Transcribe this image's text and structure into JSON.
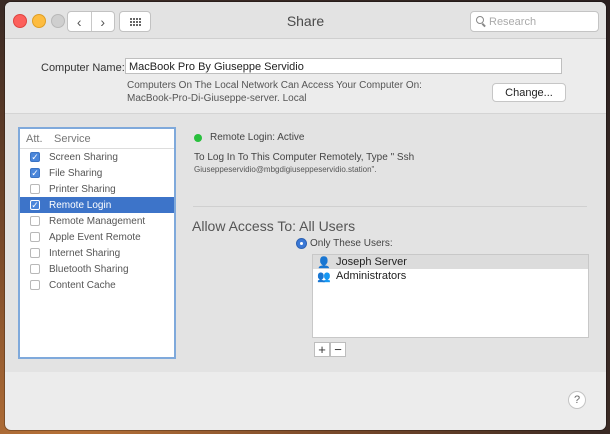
{
  "window": {
    "title": "Share"
  },
  "nav": {
    "back_icon": "‹",
    "forward_icon": "›"
  },
  "search": {
    "placeholder": "Research"
  },
  "computer": {
    "label": "Computer Name:",
    "value": "MacBook Pro By Giuseppe Servidio",
    "info_line1": "Computers On The Local Network Can Access Your Computer On:",
    "info_line2": "MacBook-Pro-Di-Giuseppe-server. Local",
    "change_label": "Change..."
  },
  "services": {
    "header_att": "Att.",
    "header_service": "Service",
    "items": [
      {
        "label": "Screen Sharing",
        "checked": true,
        "selected": false
      },
      {
        "label": "File Sharing",
        "checked": true,
        "selected": false
      },
      {
        "label": "Printer Sharing",
        "checked": false,
        "selected": false
      },
      {
        "label": "Remote Login",
        "checked": true,
        "selected": true
      },
      {
        "label": "Remote Management",
        "checked": false,
        "selected": false
      },
      {
        "label": "Apple Event Remote",
        "checked": false,
        "selected": false
      },
      {
        "label": "Internet Sharing",
        "checked": false,
        "selected": false
      },
      {
        "label": "Bluetooth Sharing",
        "checked": false,
        "selected": false
      },
      {
        "label": "Content Cache",
        "checked": false,
        "selected": false
      }
    ]
  },
  "status": {
    "text": "Remote Login: Active",
    "instruction": "To Log In To This Computer Remotely, Type \" Ssh",
    "address": "Giuseppeservidio@mbgdigiuseppeservidio.station\"."
  },
  "access": {
    "label": "Allow Access To: All Users",
    "option_label": "Only These Users:",
    "users": [
      {
        "icon": "👤",
        "name": "Joseph Server",
        "selected": true
      },
      {
        "icon": "👥",
        "name": "Administrators",
        "selected": false
      }
    ],
    "add_label": "+",
    "remove_label": "−"
  },
  "help": {
    "label": "?"
  },
  "colors": {
    "accent": "#3d74c9",
    "status_active": "#29c03d"
  }
}
